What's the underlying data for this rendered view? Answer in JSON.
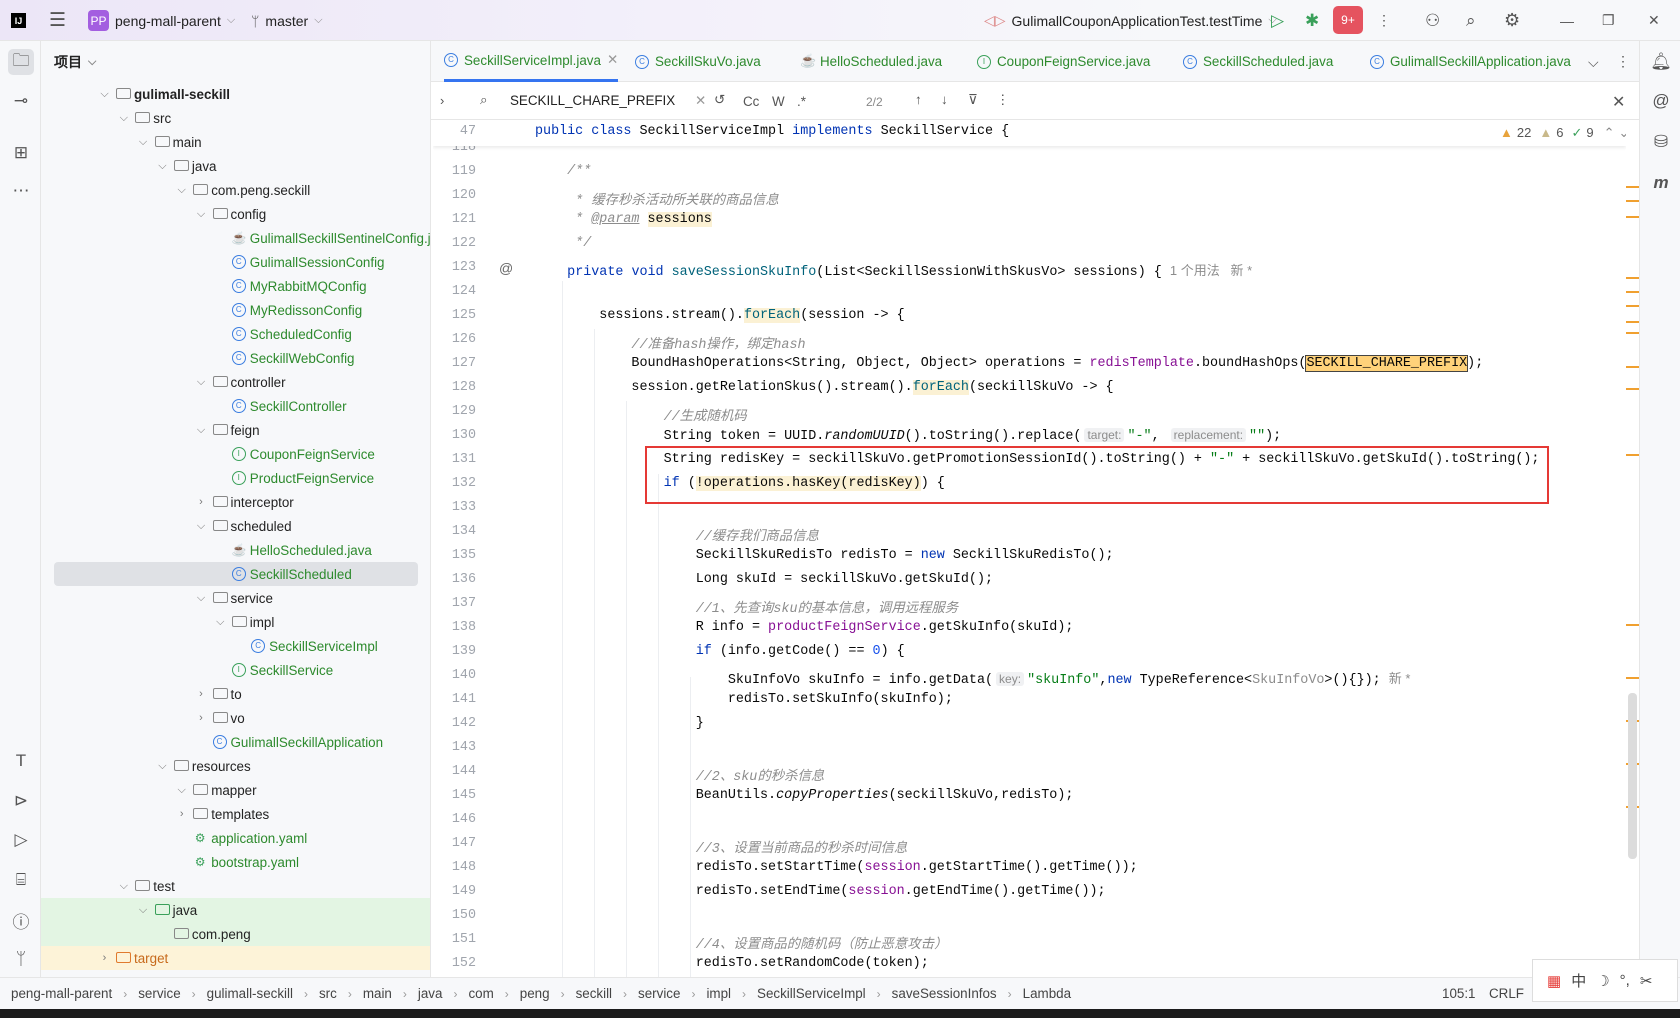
{
  "titlebar": {
    "project_badge": "PP",
    "project": "peng-mall-parent",
    "branch": "master",
    "run_config": "GulimallCouponApplicationTest.testTime",
    "updates_badge": "9+"
  },
  "project_panel": {
    "title": "项目",
    "tree": [
      {
        "label": "gulimall-seckill",
        "level": 0,
        "state": "open",
        "icon": "module-folder-icon",
        "bold": true
      },
      {
        "label": "src",
        "level": 1,
        "state": "open",
        "icon": "folder-icon"
      },
      {
        "label": "main",
        "level": 2,
        "state": "open",
        "icon": "folder-icon"
      },
      {
        "label": "java",
        "level": 3,
        "state": "open",
        "icon": "source-folder-icon"
      },
      {
        "label": "com.peng.seckill",
        "level": 4,
        "state": "open",
        "icon": "package-icon"
      },
      {
        "label": "config",
        "level": 5,
        "state": "open",
        "icon": "package-icon"
      },
      {
        "label": "GulimallSeckillSentinelConfig.java",
        "level": 6,
        "icon": "java-file-icon",
        "color": "green"
      },
      {
        "label": "GulimallSessionConfig",
        "level": 6,
        "icon": "class-icon",
        "color": "green"
      },
      {
        "label": "MyRabbitMQConfig",
        "level": 6,
        "icon": "class-icon",
        "color": "green"
      },
      {
        "label": "MyRedissonConfig",
        "level": 6,
        "icon": "class-icon",
        "color": "green"
      },
      {
        "label": "ScheduledConfig",
        "level": 6,
        "icon": "class-icon",
        "color": "green"
      },
      {
        "label": "SeckillWebConfig",
        "level": 6,
        "icon": "class-icon",
        "color": "green"
      },
      {
        "label": "controller",
        "level": 5,
        "state": "open",
        "icon": "package-icon"
      },
      {
        "label": "SeckillController",
        "level": 6,
        "icon": "class-icon",
        "color": "green"
      },
      {
        "label": "feign",
        "level": 5,
        "state": "open",
        "icon": "package-icon"
      },
      {
        "label": "CouponFeignService",
        "level": 6,
        "icon": "interface-icon",
        "color": "green"
      },
      {
        "label": "ProductFeignService",
        "level": 6,
        "icon": "interface-icon",
        "color": "green"
      },
      {
        "label": "interceptor",
        "level": 5,
        "state": "closed",
        "icon": "package-icon"
      },
      {
        "label": "scheduled",
        "level": 5,
        "state": "open",
        "icon": "package-icon"
      },
      {
        "label": "HelloScheduled.java",
        "level": 6,
        "icon": "java-file-icon",
        "color": "green"
      },
      {
        "label": "SeckillScheduled",
        "level": 6,
        "icon": "class-icon",
        "color": "green",
        "selected": true
      },
      {
        "label": "service",
        "level": 5,
        "state": "open",
        "icon": "package-icon"
      },
      {
        "label": "impl",
        "level": 6,
        "state": "open",
        "icon": "package-icon"
      },
      {
        "label": "SeckillServiceImpl",
        "level": 7,
        "icon": "class-icon",
        "color": "green"
      },
      {
        "label": "SeckillService",
        "level": 6,
        "icon": "interface-icon",
        "color": "green"
      },
      {
        "label": "to",
        "level": 5,
        "state": "closed",
        "icon": "package-icon"
      },
      {
        "label": "vo",
        "level": 5,
        "state": "closed",
        "icon": "package-icon"
      },
      {
        "label": "GulimallSeckillApplication",
        "level": 5,
        "icon": "spring-boot-class-icon",
        "color": "green"
      },
      {
        "label": "resources",
        "level": 3,
        "state": "open",
        "icon": "resources-folder-icon"
      },
      {
        "label": "mapper",
        "level": 4,
        "state": "open",
        "icon": "folder-icon"
      },
      {
        "label": "templates",
        "level": 4,
        "state": "closed",
        "icon": "folder-icon"
      },
      {
        "label": "application.yaml",
        "level": 4,
        "icon": "yaml-icon",
        "color": "green"
      },
      {
        "label": "bootstrap.yaml",
        "level": 4,
        "icon": "yaml-icon",
        "color": "green"
      },
      {
        "label": "test",
        "level": 1,
        "state": "open",
        "icon": "folder-icon"
      },
      {
        "label": "java",
        "level": 2,
        "state": "open",
        "icon": "test-folder-icon",
        "bg": "test"
      },
      {
        "label": "com.peng",
        "level": 3,
        "icon": "package-icon",
        "bg": "test"
      },
      {
        "label": "target",
        "level": 0,
        "state": "closed",
        "icon": "excluded-folder-icon",
        "bg": "excluded",
        "color": "orange"
      }
    ]
  },
  "tabs": [
    {
      "label": "SeckillServiceImpl.java",
      "icon": "class-icon",
      "active": true
    },
    {
      "label": "SeckillSkuVo.java",
      "icon": "class-icon"
    },
    {
      "label": "HelloScheduled.java",
      "icon": "java-file-icon"
    },
    {
      "label": "CouponFeignService.java",
      "icon": "interface-icon"
    },
    {
      "label": "SeckillScheduled.java",
      "icon": "class-icon"
    },
    {
      "label": "GulimallSeckillApplication.java",
      "icon": "spring-boot-class-icon"
    }
  ],
  "find": {
    "query": "SECKILL_CHARE_PREFIX",
    "match_case": "Cc",
    "words": "W",
    "regex": ".*",
    "count": "2/2"
  },
  "inspections": {
    "warnings": "22",
    "weak_warnings": "6",
    "ok": "9"
  },
  "sticky": {
    "line": "47",
    "tokens": [
      [
        "kw",
        "public class "
      ],
      [
        "",
        "SeckillServiceImpl "
      ],
      [
        "kw",
        "implements "
      ],
      [
        "",
        "SeckillService {"
      ]
    ]
  },
  "code": [
    {
      "n": "118",
      "t": []
    },
    {
      "n": "119",
      "t": [
        [
          "cm",
          "    /**"
        ]
      ]
    },
    {
      "n": "120",
      "t": [
        [
          "cm",
          "     * 缓存秒杀活动所关联的商品信息"
        ]
      ]
    },
    {
      "n": "121",
      "t": [
        [
          "cm",
          "     * "
        ],
        [
          "tag",
          "@param"
        ],
        [
          "cm",
          " "
        ],
        [
          "param",
          "sessions"
        ]
      ]
    },
    {
      "n": "122",
      "t": [
        [
          "cm",
          "     */"
        ]
      ]
    },
    {
      "n": "123",
      "t": [
        [
          "",
          "    "
        ],
        [
          "kw",
          "private void "
        ],
        [
          "fn",
          "saveSessionSkuInfo"
        ],
        [
          "",
          "(List<SeckillSessionWithSkusVo> sessions) { "
        ],
        [
          "hint",
          "1 个用法   新 *"
        ]
      ]
    },
    {
      "n": "124",
      "t": []
    },
    {
      "n": "125",
      "t": [
        [
          "",
          "        sessions.stream()."
        ],
        [
          "fn hl",
          "forEach"
        ],
        [
          "",
          "(session -> {"
        ]
      ]
    },
    {
      "n": "126",
      "t": [
        [
          "cm",
          "            //准备hash操作，绑定hash"
        ]
      ]
    },
    {
      "n": "127",
      "t": [
        [
          "",
          "            BoundHashOperations<String, Object, Object> operations = "
        ],
        [
          "field",
          "redisTemplate"
        ],
        [
          "",
          ".boundHashOps("
        ],
        [
          "match",
          "SECKILL_CHARE_PREFIX"
        ],
        [
          "",
          ");"
        ]
      ]
    },
    {
      "n": "128",
      "t": [
        [
          "",
          "            session.getRelationSkus().stream()."
        ],
        [
          "fn hl",
          "forEach"
        ],
        [
          "",
          "(seckillSkuVo -> {"
        ]
      ]
    },
    {
      "n": "129",
      "t": [
        [
          "cm",
          "                //生成随机码"
        ]
      ]
    },
    {
      "n": "130",
      "t": [
        [
          "",
          "                String token = UUID."
        ],
        [
          "it",
          "randomUUID"
        ],
        [
          "",
          "().toString().replace("
        ],
        [
          "inlay",
          "target:"
        ],
        [
          "str",
          "\"-\""
        ],
        [
          "",
          ", "
        ],
        [
          "inlay",
          "replacement:"
        ],
        [
          "str",
          "\"\""
        ],
        [
          "",
          ");"
        ]
      ]
    },
    {
      "n": "131",
      "t": [
        [
          "",
          "                String redisKey = seckillSkuVo.getPromotionSessionId().toString() + "
        ],
        [
          "str",
          "\"-\""
        ],
        [
          "",
          " + seckillSkuVo.getSkuId().toString();"
        ]
      ]
    },
    {
      "n": "132",
      "t": [
        [
          "",
          "                "
        ],
        [
          "kw",
          "if"
        ],
        [
          "",
          " ("
        ],
        [
          "hl",
          "!operations.hasKey(redisKey)"
        ],
        [
          "",
          ") {"
        ]
      ]
    },
    {
      "n": "133",
      "t": []
    },
    {
      "n": "134",
      "t": [
        [
          "cm",
          "                    //缓存我们商品信息"
        ]
      ]
    },
    {
      "n": "135",
      "t": [
        [
          "",
          "                    SeckillSkuRedisTo redisTo = "
        ],
        [
          "kw",
          "new"
        ],
        [
          "",
          " SeckillSkuRedisTo();"
        ]
      ]
    },
    {
      "n": "136",
      "t": [
        [
          "",
          "                    Long skuId = seckillSkuVo.getSkuId();"
        ]
      ]
    },
    {
      "n": "137",
      "t": [
        [
          "cm",
          "                    //1、先查询sku的基本信息，调用远程服务"
        ]
      ]
    },
    {
      "n": "138",
      "t": [
        [
          "",
          "                    R info = "
        ],
        [
          "field",
          "productFeignService"
        ],
        [
          "",
          ".getSkuInfo(skuId);"
        ]
      ]
    },
    {
      "n": "139",
      "t": [
        [
          "",
          "                    "
        ],
        [
          "kw",
          "if"
        ],
        [
          "",
          " (info.getCode() == "
        ],
        [
          "num",
          "0"
        ],
        [
          "",
          ") {"
        ]
      ]
    },
    {
      "n": "140",
      "t": [
        [
          "",
          "                        SkuInfoVo skuInfo = info.getData("
        ],
        [
          "inlay",
          "key:"
        ],
        [
          "str",
          "\"skuInfo\""
        ],
        [
          "",
          ","
        ],
        [
          "kw",
          "new"
        ],
        [
          "",
          " TypeReference<"
        ],
        [
          "gray",
          "SkuInfoVo"
        ],
        [
          "",
          ">(){}); "
        ],
        [
          "hint",
          "新 *"
        ]
      ]
    },
    {
      "n": "141",
      "t": [
        [
          "",
          "                        redisTo.setSkuInfo(skuInfo);"
        ]
      ]
    },
    {
      "n": "142",
      "t": [
        [
          "",
          "                    }"
        ]
      ]
    },
    {
      "n": "143",
      "t": []
    },
    {
      "n": "144",
      "t": [
        [
          "cm",
          "                    //2、sku的秒杀信息"
        ]
      ]
    },
    {
      "n": "145",
      "t": [
        [
          "",
          "                    BeanUtils."
        ],
        [
          "it",
          "copyProperties"
        ],
        [
          "",
          "(seckillSkuVo,redisTo);"
        ]
      ]
    },
    {
      "n": "146",
      "t": []
    },
    {
      "n": "147",
      "t": [
        [
          "cm",
          "                    //3、设置当前商品的秒杀时间信息"
        ]
      ]
    },
    {
      "n": "148",
      "t": [
        [
          "",
          "                    redisTo.setStartTime("
        ],
        [
          "field",
          "session"
        ],
        [
          "",
          ".getStartTime().getTime());"
        ]
      ]
    },
    {
      "n": "149",
      "t": [
        [
          "",
          "                    redisTo.setEndTime("
        ],
        [
          "field",
          "session"
        ],
        [
          "",
          ".getEndTime().getTime());"
        ]
      ]
    },
    {
      "n": "150",
      "t": []
    },
    {
      "n": "151",
      "t": [
        [
          "cm",
          "                    //4、设置商品的随机码（防止恶意攻击）"
        ]
      ]
    },
    {
      "n": "152",
      "t": [
        [
          "",
          "                    redisTo.setRandomCode(token);"
        ]
      ]
    }
  ],
  "statusbar": {
    "breadcrumbs": [
      "peng-mall-parent",
      "service",
      "gulimall-seckill",
      "src",
      "main",
      "java",
      "com",
      "peng",
      "seckill",
      "service",
      "impl",
      "SeckillServiceImpl",
      "saveSessionInfos",
      "Lambda"
    ],
    "position": "105:1",
    "line_sep": "CRLF"
  },
  "ime": {
    "lang": "中"
  },
  "colors": {
    "accent": "#3574f0",
    "highlight_box": "#e53935",
    "search_match": "#ffd27a"
  }
}
